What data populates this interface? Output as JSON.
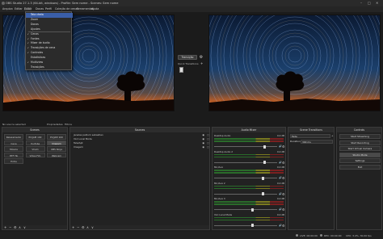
{
  "window": {
    "title": "OBS Studio 27.1.3 (64-bit, windows) - Profile: Sem nome - Scenes: Sem nome"
  },
  "menu": [
    "Arquivo",
    "Editar",
    "Exibir",
    "Docas",
    "Perfil",
    "Coleção de cenas",
    "Ferramentas",
    "Ajuda"
  ],
  "view_menu": {
    "items": [
      {
        "label": "Tela cheia",
        "checked": false,
        "selected": true
      },
      {
        "label": "Zoom",
        "checked": false,
        "selected": false
      },
      {
        "label": "Docas",
        "checked": false,
        "selected": false
      },
      {
        "label": "Ajustes",
        "checked": false,
        "selected": false
      },
      {
        "label": "Cenas",
        "checked": true,
        "selected": false
      },
      {
        "label": "Fontes",
        "checked": true,
        "selected": false
      },
      {
        "label": "Mixer de áudio",
        "checked": true,
        "selected": false
      },
      {
        "label": "Transições de cena",
        "checked": true,
        "selected": false
      },
      {
        "label": "Controles",
        "checked": true,
        "selected": false
      },
      {
        "label": "Estatísticas",
        "checked": false,
        "selected": false
      },
      {
        "label": "Multiview",
        "checked": true,
        "selected": false
      },
      {
        "label": "Transições",
        "checked": false,
        "selected": false
      }
    ]
  },
  "transition_ctl": {
    "button": "Transição",
    "quick_label": "Quick Transitions"
  },
  "status_line": {
    "left": "No source selected",
    "props": "Propriedades",
    "filters": "Filtros"
  },
  "scenes": {
    "title": "Scenes",
    "items": [
      "Relaxamento",
      "PC/JAM 100",
      "PC/JAM 100",
      "Cena",
      "YouTube",
      "Imagem",
      "Música",
      "VCam",
      "OBS Ninja",
      "HTF Tik",
      "Vídeo Fim",
      "Webcam",
      "Extra"
    ]
  },
  "sources": {
    "title": "Sources",
    "items": [
      "janelas pallium sebastian",
      "VLC Local Mode",
      "Tela/Apt",
      "Imagem"
    ]
  },
  "mixer": {
    "title": "Audio Mixer",
    "channels": [
      {
        "name": "Desktop Audio",
        "db": "0.0 dB",
        "level": 0.8
      },
      {
        "name": "Desktop Audio 2",
        "db": "0.0 dB",
        "level": 0.8
      },
      {
        "name": "Mic/Aux",
        "db": "0.0 dB",
        "level": 0.78
      },
      {
        "name": "Mic/Aux 2",
        "db": "0.0 dB",
        "level": 0.78
      },
      {
        "name": "Mic/Aux 3",
        "db": "0.0 dB",
        "level": 0.6
      },
      {
        "name": "VLC Local Mode",
        "db": "0.0 dB",
        "level": 0.6
      }
    ]
  },
  "transitions": {
    "title": "Scene Transitions",
    "selected": "Fade",
    "duration_label": "Duration",
    "duration_value": "300 ms"
  },
  "controls": {
    "title": "Controls",
    "buttons": [
      "Start Streaming",
      "Start Recording",
      "Start Virtual Camera",
      "Studio Mode",
      "Settings",
      "Exit"
    ],
    "highlight_index": 3
  },
  "statusbar": {
    "live": "LIVE: 00:00:00",
    "rec": "REC: 00:00:00",
    "cpu": "CPU: 3.4%, 30.00 fps"
  }
}
